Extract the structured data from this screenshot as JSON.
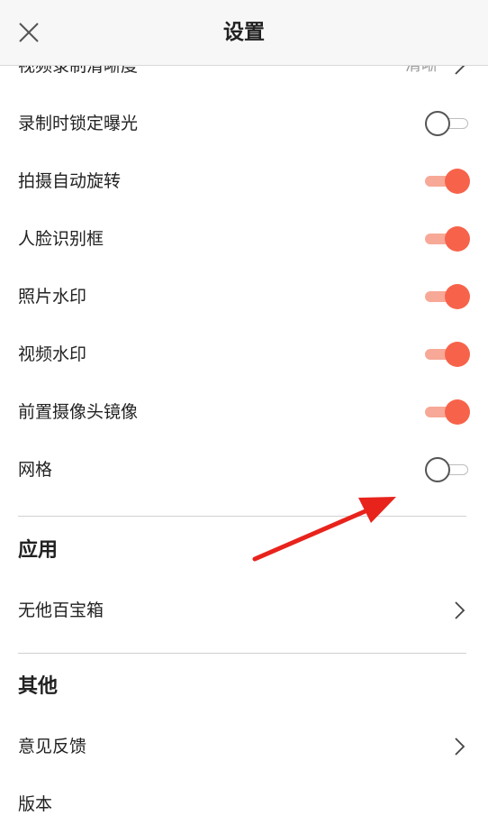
{
  "header": {
    "title": "设置",
    "close_icon": "close-icon"
  },
  "rows": [
    {
      "label": "视频录制清晰度",
      "value": "清晰",
      "kind": "nav"
    },
    {
      "label": "录制时锁定曝光",
      "kind": "toggle",
      "on": false
    },
    {
      "label": "拍摄自动旋转",
      "kind": "toggle",
      "on": true
    },
    {
      "label": "人脸识别框",
      "kind": "toggle",
      "on": true
    },
    {
      "label": "照片水印",
      "kind": "toggle",
      "on": true
    },
    {
      "label": "视频水印",
      "kind": "toggle",
      "on": true
    },
    {
      "label": "前置摄像头镜像",
      "kind": "toggle",
      "on": true
    },
    {
      "label": "网格",
      "kind": "toggle",
      "on": false
    }
  ],
  "sections": {
    "app": {
      "title": "应用",
      "items": [
        {
          "label": "无他百宝箱"
        }
      ]
    },
    "other": {
      "title": "其他",
      "items": [
        {
          "label": "意见反馈"
        },
        {
          "label": "版本"
        }
      ]
    }
  },
  "colors": {
    "toggle_on_knob": "#f7634a",
    "toggle_on_track": "#f7a896",
    "arrow": "#e8231c"
  }
}
